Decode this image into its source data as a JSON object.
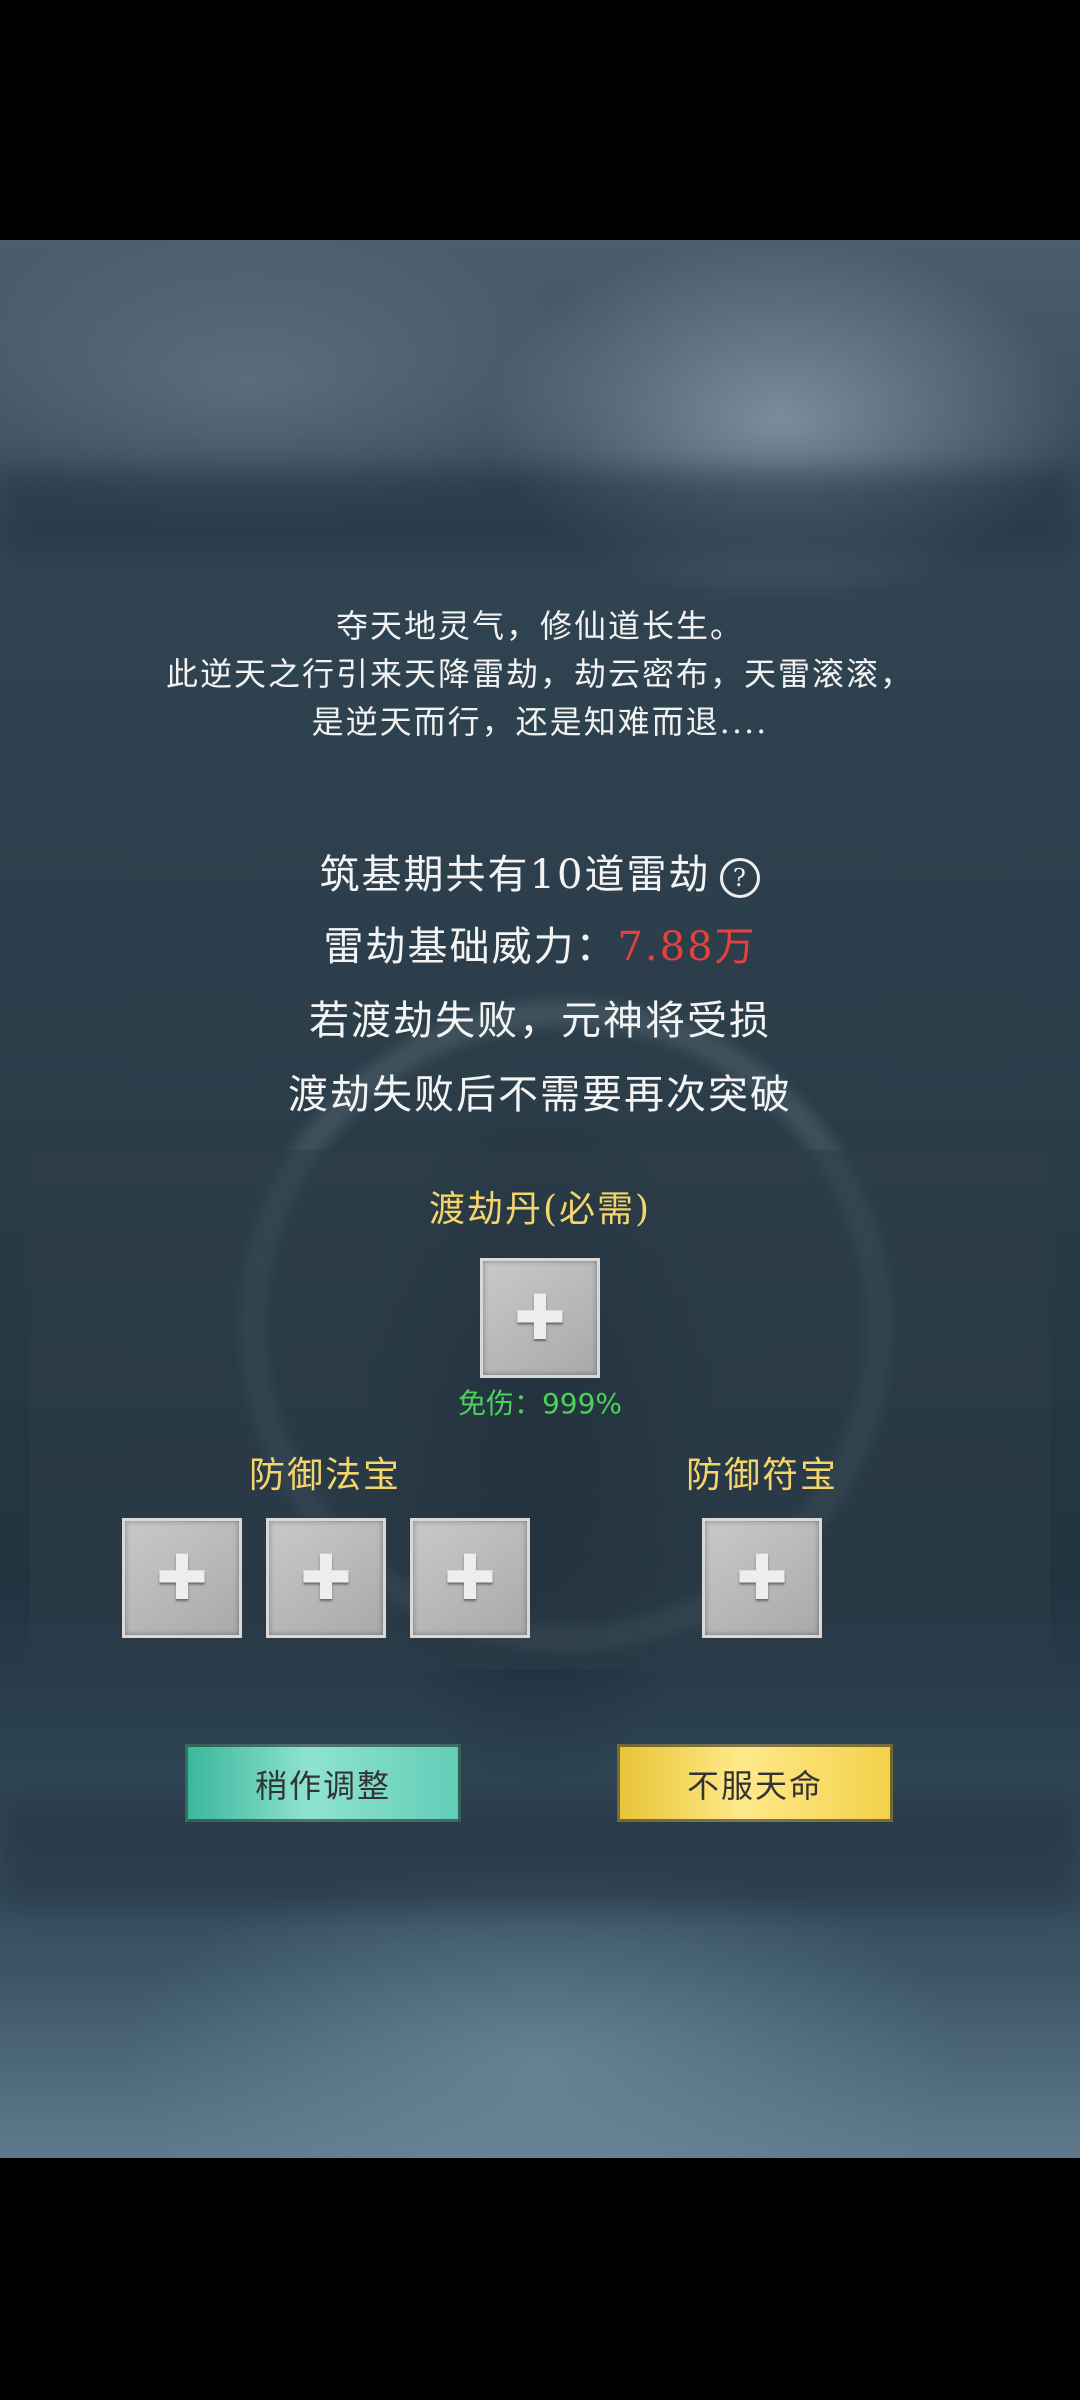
{
  "intro": {
    "line1": "夺天地灵气，修仙道长生。",
    "line2": "此逆天之行引来天降雷劫，劫云密布，天雷滚滚，",
    "line3": "是逆天而行，还是知难而退...."
  },
  "info": {
    "stage_line": "筑基期共有10道雷劫",
    "power_label": "雷劫基础威力：",
    "power_value": "7.88万",
    "fail_line1": "若渡劫失败，元神将受损",
    "fail_line2": "渡劫失败后不需要再次突破"
  },
  "pill": {
    "title": "渡劫丹(必需)",
    "immunity": "免伤：999%"
  },
  "defense_treasure": {
    "title": "防御法宝"
  },
  "defense_talisman": {
    "title": "防御符宝"
  },
  "buttons": {
    "adjust": "稍作调整",
    "defy": "不服天命"
  },
  "icons": {
    "help": "question-circle-icon",
    "add": "plus-icon"
  },
  "colors": {
    "title_gold": "#f3d56b",
    "power_red": "#e8403a",
    "immunity_green": "#4cd15a",
    "adjust_teal": "#62cdb7",
    "defy_yellow": "#f3d14b"
  }
}
